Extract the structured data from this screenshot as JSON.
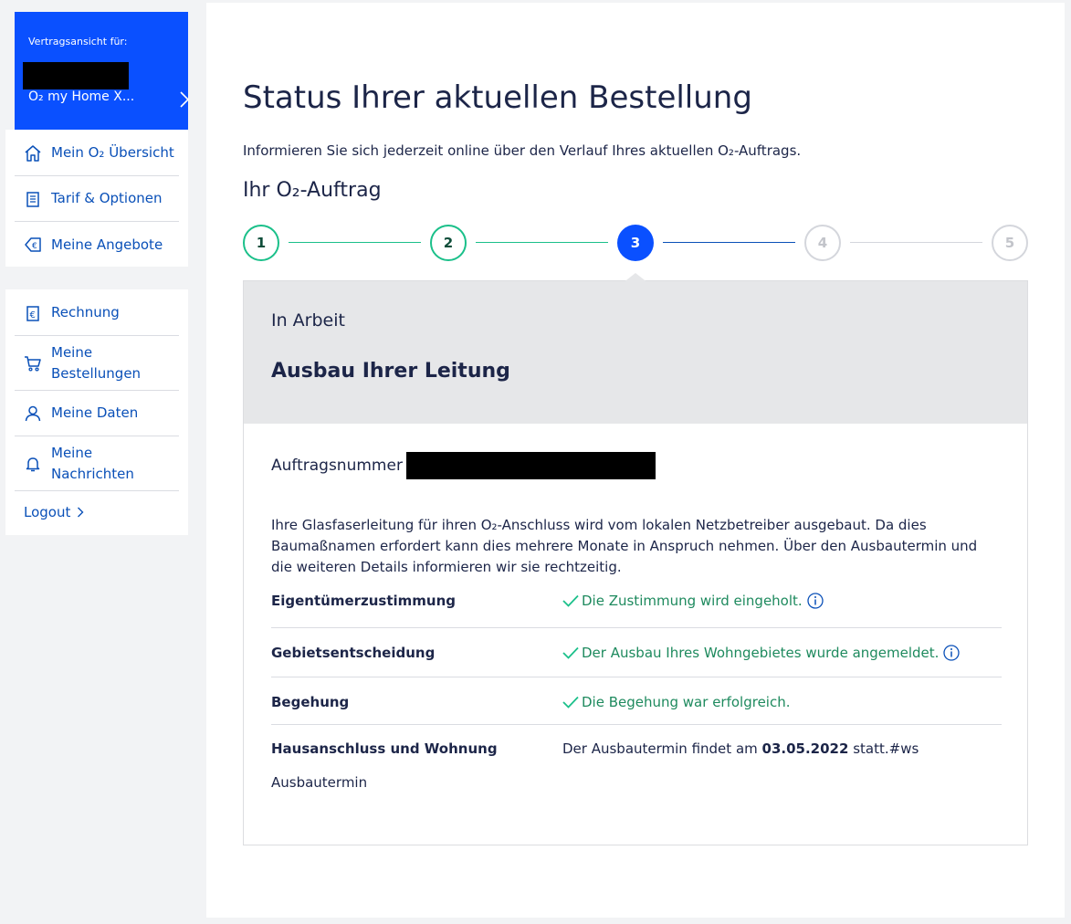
{
  "sidebar": {
    "contract": {
      "label": "Vertragsansicht für:",
      "name": "O₂ my Home X..."
    },
    "top_items": [
      {
        "label": "Mein O₂ Übersicht",
        "icon": "home-icon"
      },
      {
        "label": "Tarif & Optionen",
        "icon": "document-icon"
      },
      {
        "label": "Meine Angebote",
        "icon": "euro-tag-icon"
      }
    ],
    "bottom_items": [
      {
        "label": "Rechnung",
        "icon": "invoice-icon"
      },
      {
        "label": "Meine Bestellungen",
        "icon": "cart-icon"
      },
      {
        "label": "Meine Daten",
        "icon": "user-icon"
      },
      {
        "label": "Meine Nachrichten",
        "icon": "bell-icon"
      }
    ],
    "logout": "Logout"
  },
  "main": {
    "title": "Status Ihrer aktuellen Bestellung",
    "intro": "Informieren Sie sich jederzeit online über den Verlauf Ihres aktuellen O₂-Auftrags.",
    "section_title": "Ihr O₂-Auftrag",
    "steps": [
      {
        "number": "1",
        "state": "done"
      },
      {
        "number": "2",
        "state": "done"
      },
      {
        "number": "3",
        "state": "active"
      },
      {
        "number": "4",
        "state": "todo"
      },
      {
        "number": "5",
        "state": "todo"
      }
    ],
    "status": {
      "state": "In Arbeit",
      "headline": "Ausbau Ihrer Leitung"
    },
    "details": {
      "order_label": "Auftragsnummer :",
      "description": "Ihre Glasfaserleitung für ihren O₂-Anschluss wird vom lokalen Netzbetreiber ausgebaut. Da dies Baumaßnamen erfordert kann dies mehrere Monate in Anspruch nehmen. Über den Ausbautermin und die weiteren Details informieren wir sie rechtzeitig.",
      "rows": [
        {
          "label": "Eigentümerzustimmung",
          "value": "Die Zustimmung wird eingeholt.",
          "info": true
        },
        {
          "label": "Gebietsentscheidung",
          "value": "Der Ausbau Ihres Wohngebietes wurde angemeldet.",
          "info": true
        },
        {
          "label": "Begehung",
          "value": "Die Begehung war erfolgreich.",
          "info": false
        }
      ],
      "last_row": {
        "label": "Hausanschluss und Wohnung",
        "sub_label": "Ausbautermin",
        "text_before": "Der Ausbautermin findet am",
        "date": "03.05.2022",
        "text_after": "statt.#ws"
      }
    }
  },
  "colors": {
    "brand_blue": "#0a50ff",
    "link_blue": "#0a50b8",
    "success_green": "#1bc08a",
    "status_text_green": "#1e8a5e",
    "text_dark": "#1c2548"
  }
}
